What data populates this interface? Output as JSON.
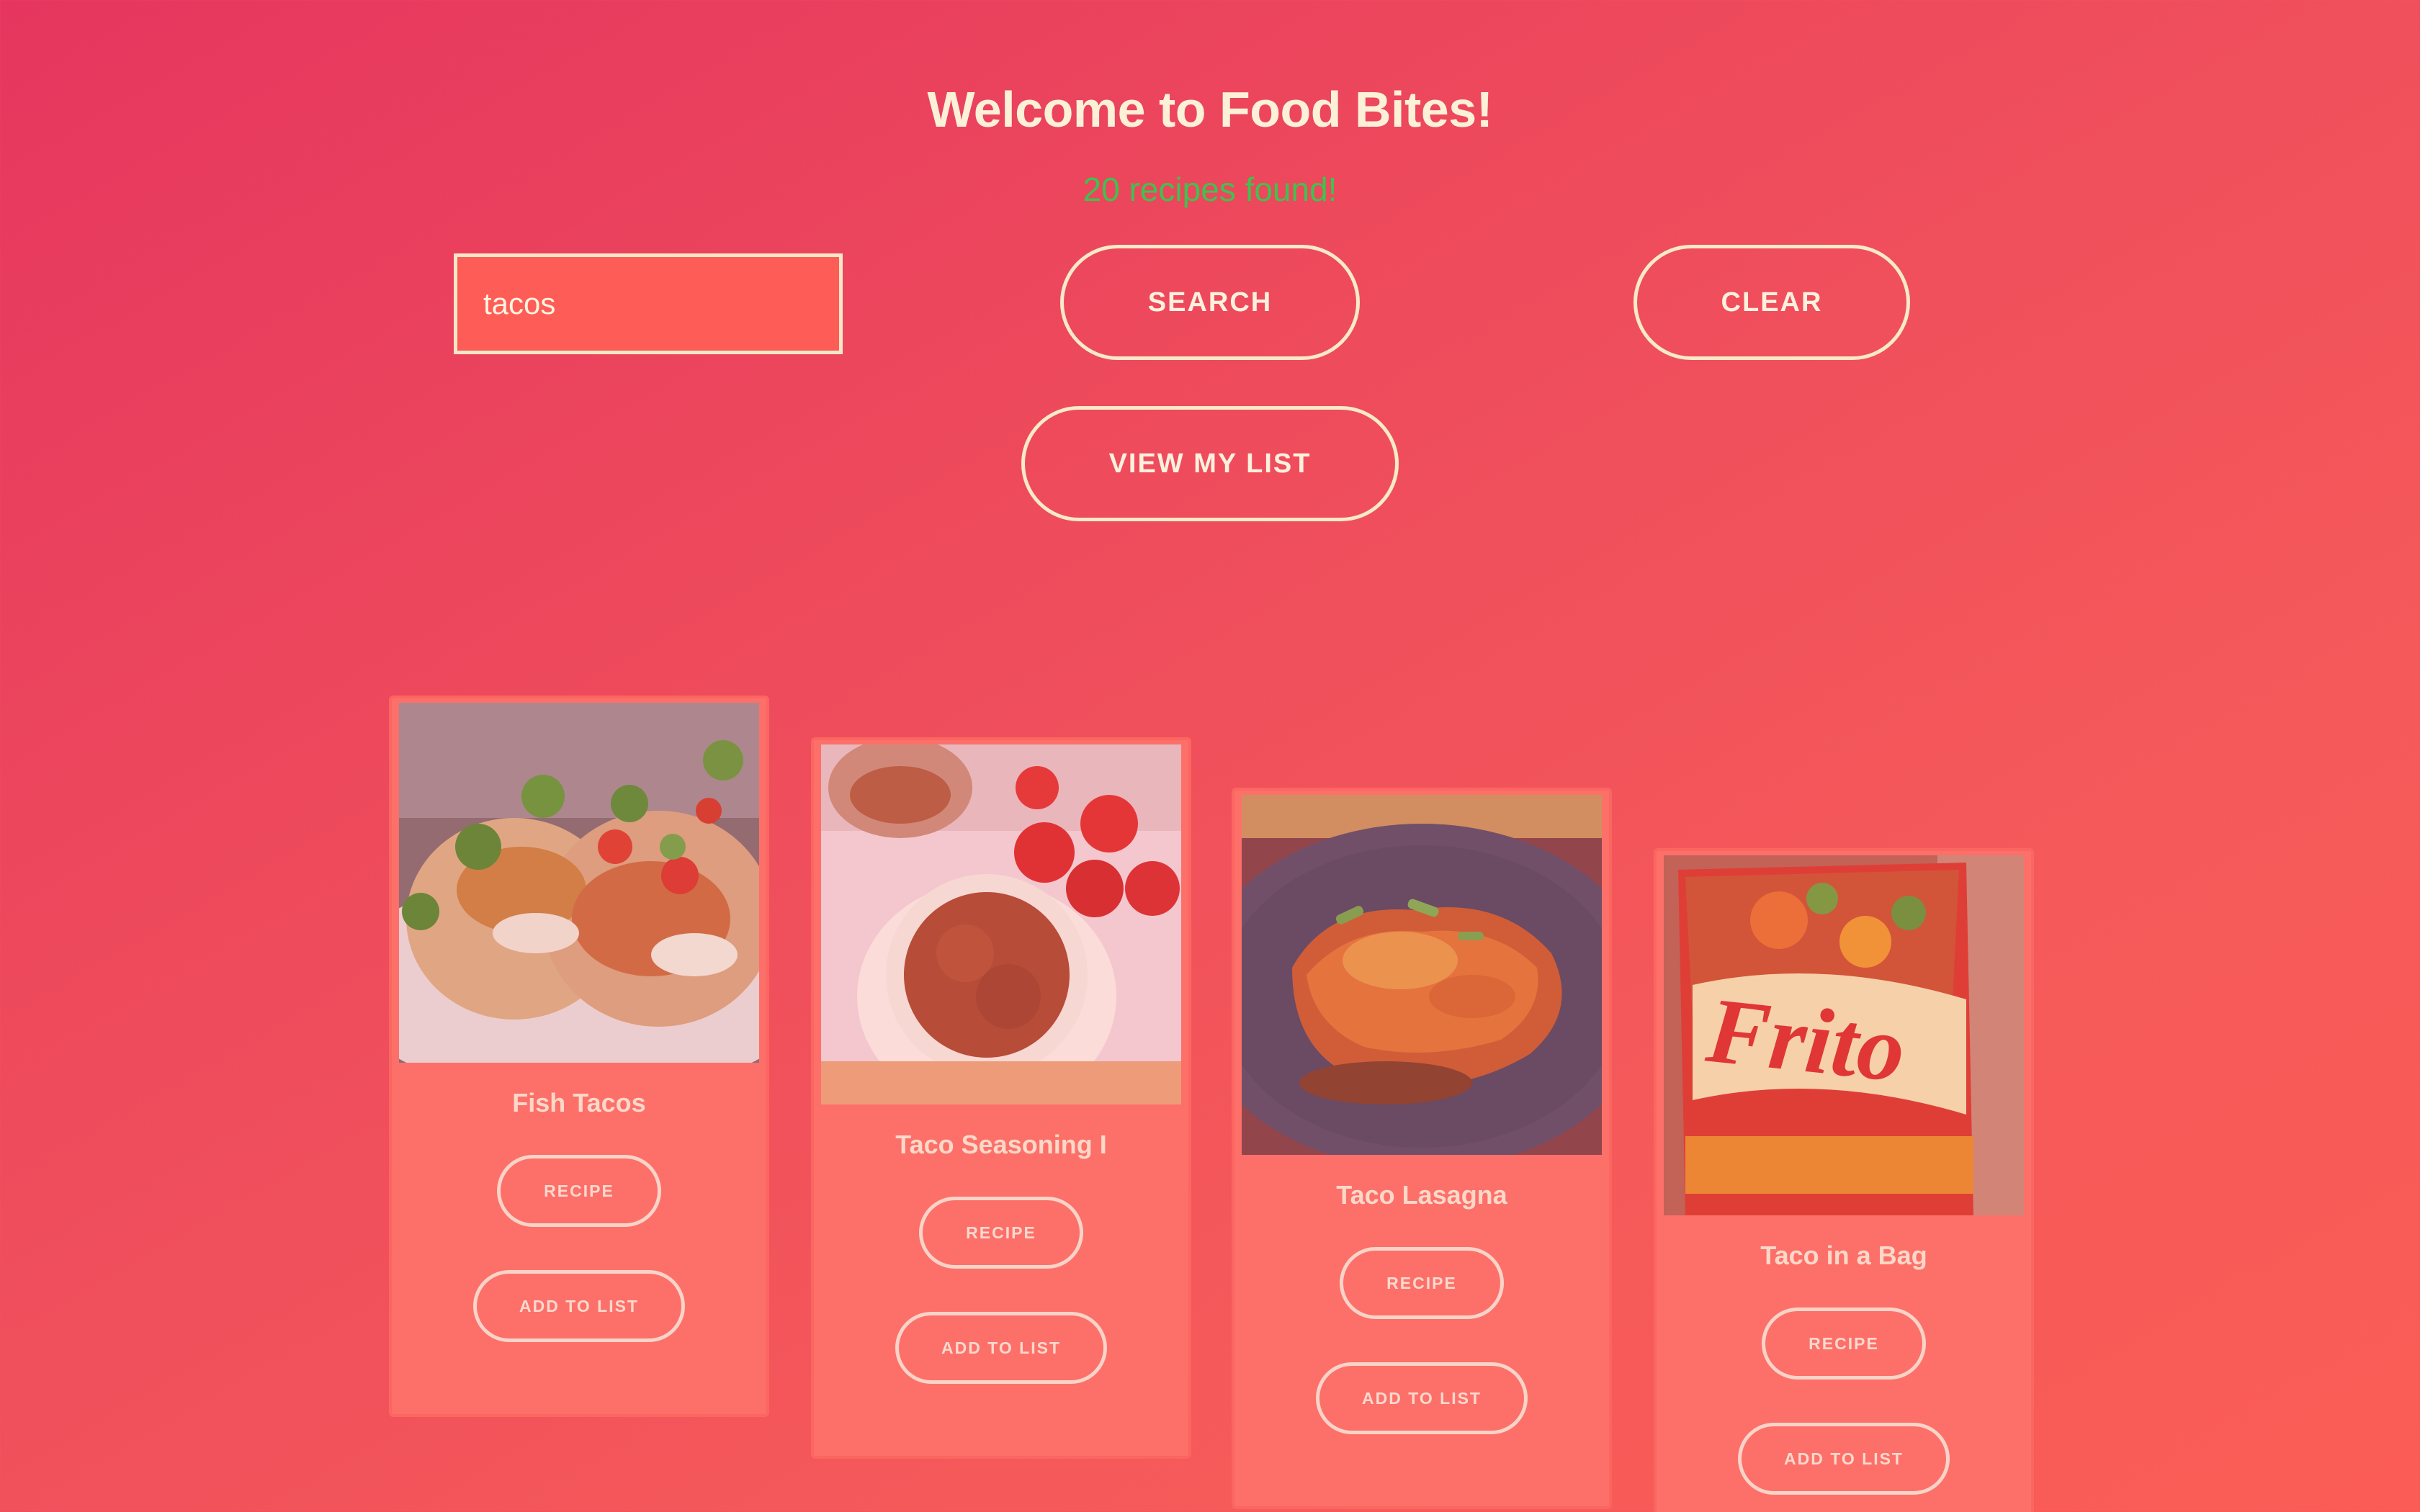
{
  "header": {
    "title": "Welcome to Food Bites!",
    "results": "20 recipes found!"
  },
  "search": {
    "value": "tacos",
    "search_label": "SEARCH",
    "clear_label": "CLEAR",
    "view_list_label": "VIEW MY LIST"
  },
  "colors": {
    "accent": "#fbf1d8",
    "success": "#3fc24f",
    "card": "#fd706a"
  },
  "recipes": [
    {
      "title": "Fish Tacos",
      "recipe_label": "RECIPE",
      "add_label": "ADD TO LIST",
      "image": "fish-tacos-photo"
    },
    {
      "title": "Taco Seasoning I",
      "recipe_label": "RECIPE",
      "add_label": "ADD TO LIST",
      "image": "taco-seasoning-photo"
    },
    {
      "title": "Taco Lasagna",
      "recipe_label": "RECIPE",
      "add_label": "ADD TO LIST",
      "image": "taco-lasagna-photo"
    },
    {
      "title": "Taco in a Bag",
      "recipe_label": "RECIPE",
      "add_label": "ADD TO LIST",
      "image": "taco-in-a-bag-photo"
    }
  ]
}
